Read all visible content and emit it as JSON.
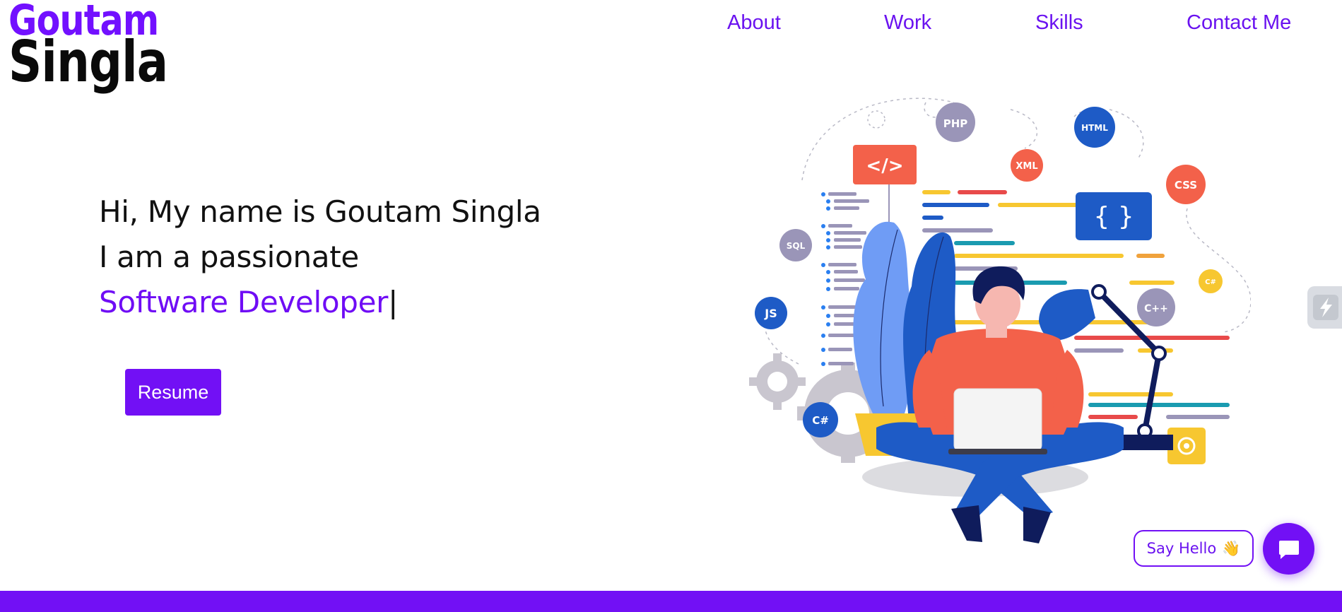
{
  "logo": {
    "line1": "Goutam",
    "line2": "Singla"
  },
  "nav": {
    "about": "About",
    "work": "Work",
    "skills": "Skills",
    "contact": "Contact Me"
  },
  "hero": {
    "line1": "Hi, My name is Goutam Singla",
    "line2": "I am a passionate",
    "role": "Software Developer",
    "caret": "|",
    "resume_label": "Resume"
  },
  "illustration": {
    "badges": {
      "php": "PHP",
      "html": "HTML",
      "xml": "XML",
      "css": "CSS",
      "sql": "SQL",
      "js": "JS",
      "csharp": "C#",
      "csharp_small": "C#",
      "cpp": "C++",
      "code_tag": "</>",
      "braces": "{   }"
    }
  },
  "chat": {
    "say_hello": "Say Hello",
    "wave": "👋"
  },
  "colors": {
    "accent": "#7210f5",
    "nav_text": "#6a12f0",
    "text": "#111111"
  }
}
